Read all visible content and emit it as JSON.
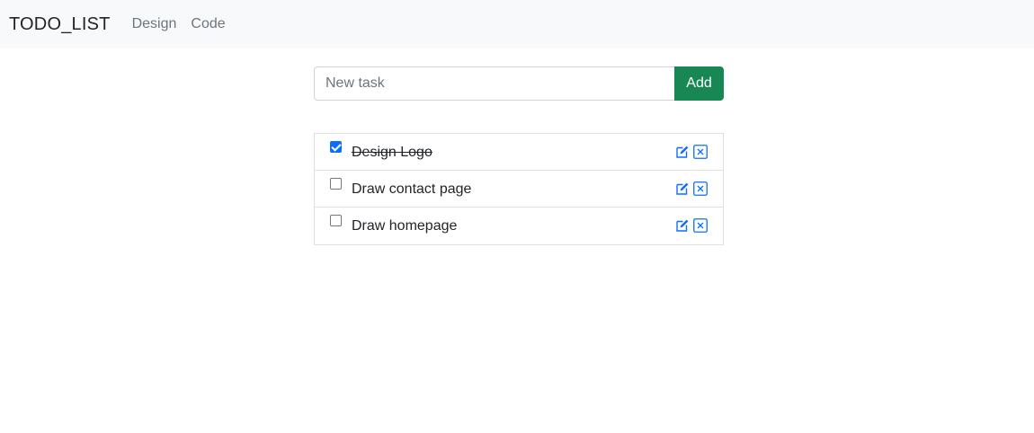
{
  "navbar": {
    "brand": "TODO_LIST",
    "links": [
      {
        "label": "Design"
      },
      {
        "label": "Code"
      }
    ]
  },
  "form": {
    "placeholder": "New task",
    "value": "",
    "add_label": "Add"
  },
  "tasks": [
    {
      "text": "Design Logo",
      "done": true
    },
    {
      "text": "Draw contact page",
      "done": false
    },
    {
      "text": "Draw homepage",
      "done": false
    }
  ],
  "icons": {
    "edit": "edit-icon",
    "delete": "close-icon"
  },
  "colors": {
    "accent": "#198754",
    "icon": "#0d6efd",
    "navbar": "#f8f9fa"
  }
}
